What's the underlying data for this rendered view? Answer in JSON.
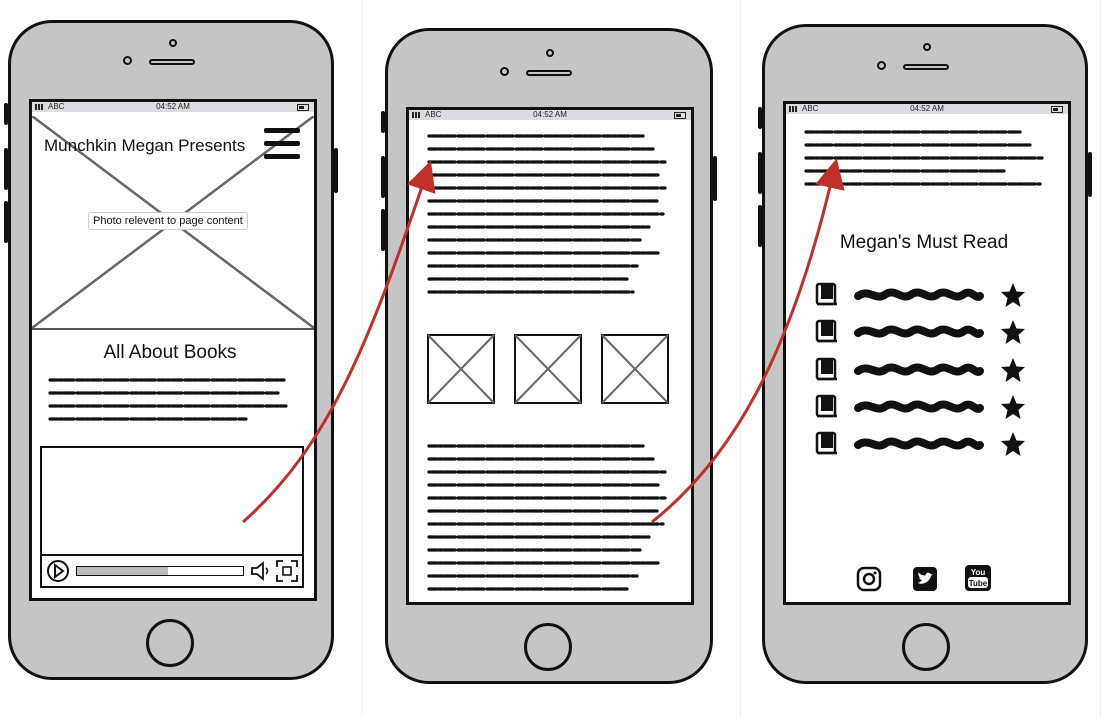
{
  "phone1": {
    "status": {
      "carrier": "ABC",
      "time": "04:52 AM"
    },
    "header": {
      "title": "Munchkin Megan Presents",
      "menu_icon": "hamburger-menu-icon"
    },
    "hero": {
      "label": "Photo relevent to page content"
    },
    "section": {
      "heading": "All About Books"
    },
    "video": {
      "controls": [
        "play-icon",
        "volume-icon",
        "fullscreen-icon"
      ],
      "progress": 0.55
    }
  },
  "phone2": {
    "status": {
      "carrier": "ABC",
      "time": "04:52 AM"
    },
    "gallery": {
      "count": 3
    }
  },
  "phone3": {
    "status": {
      "carrier": "ABC",
      "time": "04:52 AM"
    },
    "list": {
      "heading": "Megan's Must Read",
      "items": [
        {
          "icon": "book-icon",
          "rating_icon": "star-icon"
        },
        {
          "icon": "book-icon",
          "rating_icon": "star-icon"
        },
        {
          "icon": "book-icon",
          "rating_icon": "star-icon"
        },
        {
          "icon": "book-icon",
          "rating_icon": "star-icon"
        },
        {
          "icon": "book-icon",
          "rating_icon": "star-icon"
        }
      ]
    },
    "social": [
      "instagram-icon",
      "twitter-icon",
      "youtube-icon"
    ]
  },
  "colors": {
    "phone_body": "#c6c5c6",
    "outline": "#111111",
    "arrow": "#c0302b",
    "statusbar": "#d9dde1"
  }
}
